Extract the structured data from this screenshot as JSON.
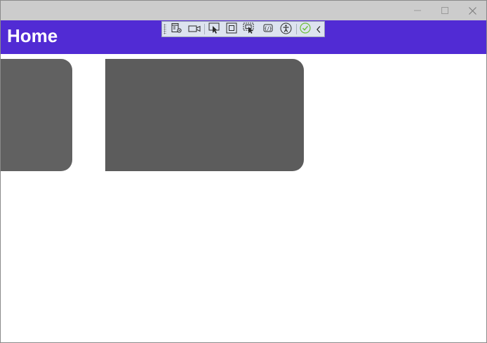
{
  "window": {
    "buttons": {
      "minimize": "minimize-icon",
      "maximize": "maximize-icon",
      "close": "close-icon"
    }
  },
  "header": {
    "title": "Home",
    "background": "#512bd4",
    "text_color": "#ffffff"
  },
  "debug_toolbar": {
    "items": [
      "go-to-live-visual-tree-icon",
      "show-in-app-toolbar-recording-icon",
      "select-element-icon",
      "display-layout-adorners-icon",
      "track-focused-element-icon",
      "hot-reload-binding-icon",
      "accessibility-icon",
      "hot-reload-ok-icon",
      "collapse-toolbar-icon"
    ],
    "status_color": "#6cbf3a"
  },
  "cards": [
    {
      "color": "#616161"
    },
    {
      "color": "#5c5c5c"
    }
  ]
}
